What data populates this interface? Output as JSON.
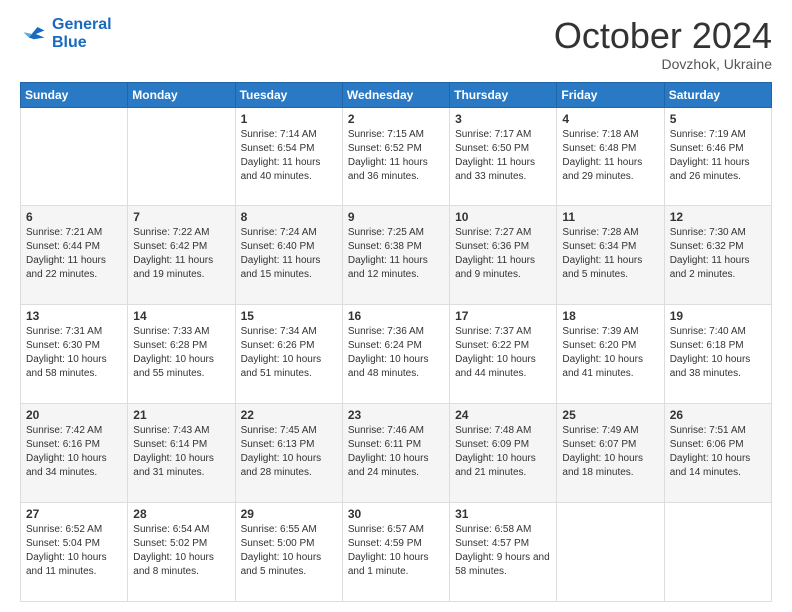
{
  "header": {
    "logo_line1": "General",
    "logo_line2": "Blue",
    "month": "October 2024",
    "location": "Dovzhok, Ukraine"
  },
  "days_of_week": [
    "Sunday",
    "Monday",
    "Tuesday",
    "Wednesday",
    "Thursday",
    "Friday",
    "Saturday"
  ],
  "weeks": [
    [
      null,
      null,
      {
        "day": 1,
        "sunrise": "Sunrise: 7:14 AM",
        "sunset": "Sunset: 6:54 PM",
        "daylight": "Daylight: 11 hours and 40 minutes."
      },
      {
        "day": 2,
        "sunrise": "Sunrise: 7:15 AM",
        "sunset": "Sunset: 6:52 PM",
        "daylight": "Daylight: 11 hours and 36 minutes."
      },
      {
        "day": 3,
        "sunrise": "Sunrise: 7:17 AM",
        "sunset": "Sunset: 6:50 PM",
        "daylight": "Daylight: 11 hours and 33 minutes."
      },
      {
        "day": 4,
        "sunrise": "Sunrise: 7:18 AM",
        "sunset": "Sunset: 6:48 PM",
        "daylight": "Daylight: 11 hours and 29 minutes."
      },
      {
        "day": 5,
        "sunrise": "Sunrise: 7:19 AM",
        "sunset": "Sunset: 6:46 PM",
        "daylight": "Daylight: 11 hours and 26 minutes."
      }
    ],
    [
      {
        "day": 6,
        "sunrise": "Sunrise: 7:21 AM",
        "sunset": "Sunset: 6:44 PM",
        "daylight": "Daylight: 11 hours and 22 minutes."
      },
      {
        "day": 7,
        "sunrise": "Sunrise: 7:22 AM",
        "sunset": "Sunset: 6:42 PM",
        "daylight": "Daylight: 11 hours and 19 minutes."
      },
      {
        "day": 8,
        "sunrise": "Sunrise: 7:24 AM",
        "sunset": "Sunset: 6:40 PM",
        "daylight": "Daylight: 11 hours and 15 minutes."
      },
      {
        "day": 9,
        "sunrise": "Sunrise: 7:25 AM",
        "sunset": "Sunset: 6:38 PM",
        "daylight": "Daylight: 11 hours and 12 minutes."
      },
      {
        "day": 10,
        "sunrise": "Sunrise: 7:27 AM",
        "sunset": "Sunset: 6:36 PM",
        "daylight": "Daylight: 11 hours and 9 minutes."
      },
      {
        "day": 11,
        "sunrise": "Sunrise: 7:28 AM",
        "sunset": "Sunset: 6:34 PM",
        "daylight": "Daylight: 11 hours and 5 minutes."
      },
      {
        "day": 12,
        "sunrise": "Sunrise: 7:30 AM",
        "sunset": "Sunset: 6:32 PM",
        "daylight": "Daylight: 11 hours and 2 minutes."
      }
    ],
    [
      {
        "day": 13,
        "sunrise": "Sunrise: 7:31 AM",
        "sunset": "Sunset: 6:30 PM",
        "daylight": "Daylight: 10 hours and 58 minutes."
      },
      {
        "day": 14,
        "sunrise": "Sunrise: 7:33 AM",
        "sunset": "Sunset: 6:28 PM",
        "daylight": "Daylight: 10 hours and 55 minutes."
      },
      {
        "day": 15,
        "sunrise": "Sunrise: 7:34 AM",
        "sunset": "Sunset: 6:26 PM",
        "daylight": "Daylight: 10 hours and 51 minutes."
      },
      {
        "day": 16,
        "sunrise": "Sunrise: 7:36 AM",
        "sunset": "Sunset: 6:24 PM",
        "daylight": "Daylight: 10 hours and 48 minutes."
      },
      {
        "day": 17,
        "sunrise": "Sunrise: 7:37 AM",
        "sunset": "Sunset: 6:22 PM",
        "daylight": "Daylight: 10 hours and 44 minutes."
      },
      {
        "day": 18,
        "sunrise": "Sunrise: 7:39 AM",
        "sunset": "Sunset: 6:20 PM",
        "daylight": "Daylight: 10 hours and 41 minutes."
      },
      {
        "day": 19,
        "sunrise": "Sunrise: 7:40 AM",
        "sunset": "Sunset: 6:18 PM",
        "daylight": "Daylight: 10 hours and 38 minutes."
      }
    ],
    [
      {
        "day": 20,
        "sunrise": "Sunrise: 7:42 AM",
        "sunset": "Sunset: 6:16 PM",
        "daylight": "Daylight: 10 hours and 34 minutes."
      },
      {
        "day": 21,
        "sunrise": "Sunrise: 7:43 AM",
        "sunset": "Sunset: 6:14 PM",
        "daylight": "Daylight: 10 hours and 31 minutes."
      },
      {
        "day": 22,
        "sunrise": "Sunrise: 7:45 AM",
        "sunset": "Sunset: 6:13 PM",
        "daylight": "Daylight: 10 hours and 28 minutes."
      },
      {
        "day": 23,
        "sunrise": "Sunrise: 7:46 AM",
        "sunset": "Sunset: 6:11 PM",
        "daylight": "Daylight: 10 hours and 24 minutes."
      },
      {
        "day": 24,
        "sunrise": "Sunrise: 7:48 AM",
        "sunset": "Sunset: 6:09 PM",
        "daylight": "Daylight: 10 hours and 21 minutes."
      },
      {
        "day": 25,
        "sunrise": "Sunrise: 7:49 AM",
        "sunset": "Sunset: 6:07 PM",
        "daylight": "Daylight: 10 hours and 18 minutes."
      },
      {
        "day": 26,
        "sunrise": "Sunrise: 7:51 AM",
        "sunset": "Sunset: 6:06 PM",
        "daylight": "Daylight: 10 hours and 14 minutes."
      }
    ],
    [
      {
        "day": 27,
        "sunrise": "Sunrise: 6:52 AM",
        "sunset": "Sunset: 5:04 PM",
        "daylight": "Daylight: 10 hours and 11 minutes."
      },
      {
        "day": 28,
        "sunrise": "Sunrise: 6:54 AM",
        "sunset": "Sunset: 5:02 PM",
        "daylight": "Daylight: 10 hours and 8 minutes."
      },
      {
        "day": 29,
        "sunrise": "Sunrise: 6:55 AM",
        "sunset": "Sunset: 5:00 PM",
        "daylight": "Daylight: 10 hours and 5 minutes."
      },
      {
        "day": 30,
        "sunrise": "Sunrise: 6:57 AM",
        "sunset": "Sunset: 4:59 PM",
        "daylight": "Daylight: 10 hours and 1 minute."
      },
      {
        "day": 31,
        "sunrise": "Sunrise: 6:58 AM",
        "sunset": "Sunset: 4:57 PM",
        "daylight": "Daylight: 9 hours and 58 minutes."
      },
      null,
      null
    ]
  ]
}
